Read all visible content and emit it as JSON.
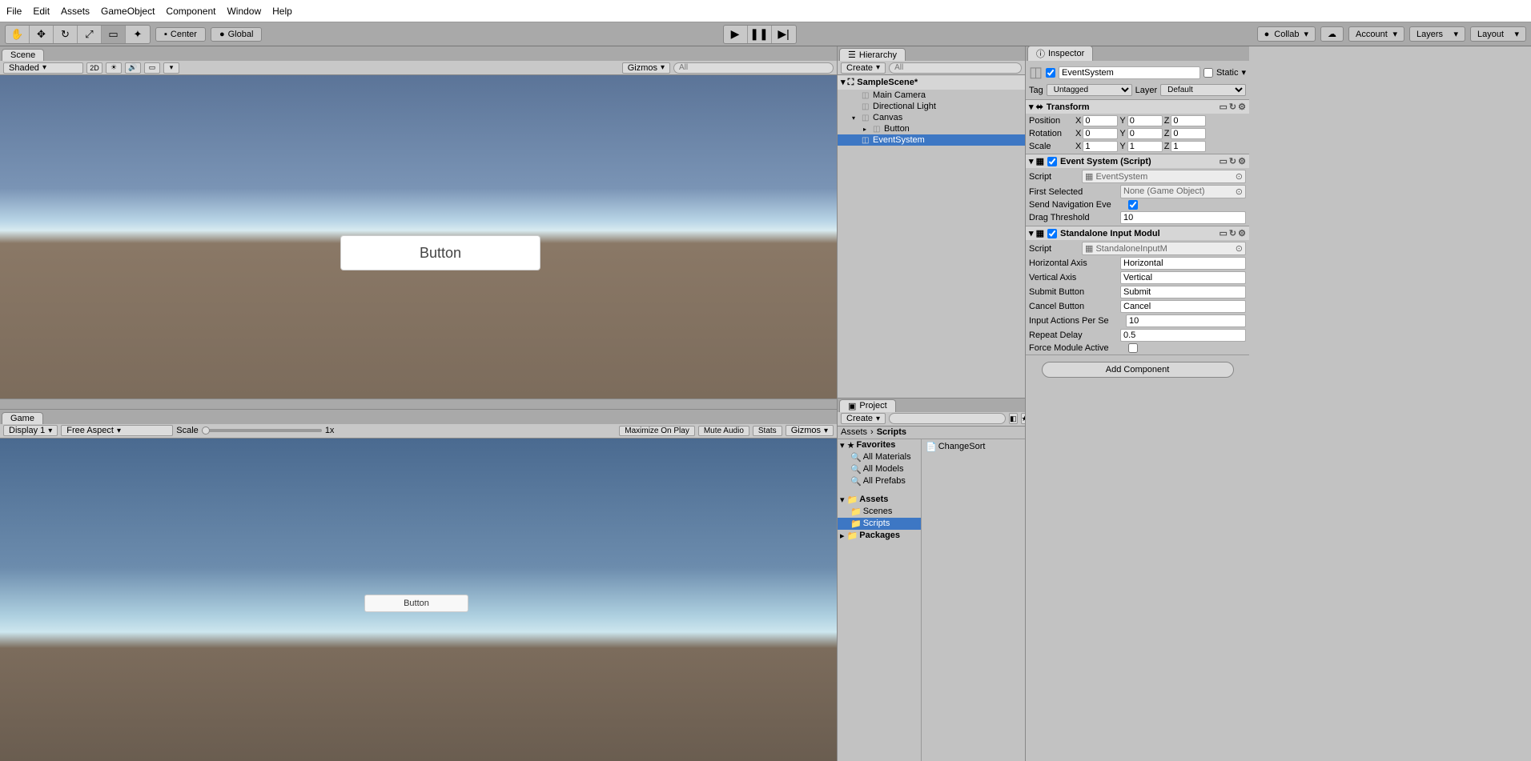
{
  "menu": [
    "File",
    "Edit",
    "Assets",
    "GameObject",
    "Component",
    "Window",
    "Help"
  ],
  "toolbar": {
    "center": "Center",
    "global": "Global",
    "collab": "Collab",
    "account": "Account",
    "layers": "Layers",
    "layout": "Layout"
  },
  "scene_tab": "Scene",
  "scene_toolbar": {
    "shaded": "Shaded",
    "two_d": "2D",
    "gizmos": "Gizmos",
    "search_ph": "All"
  },
  "scene_button_text": "Button",
  "game_tab": "Game",
  "game_toolbar": {
    "display": "Display 1",
    "aspect": "Free Aspect",
    "scale": "Scale",
    "scale_val": "1x",
    "maximize": "Maximize On Play",
    "mute": "Mute Audio",
    "stats": "Stats",
    "gizmos": "Gizmos"
  },
  "game_button_text": "Button",
  "hierarchy": {
    "title": "Hierarchy",
    "create": "Create",
    "search_ph": "All",
    "scene": "SampleScene*",
    "items": [
      {
        "label": "Main Camera",
        "indent": 1
      },
      {
        "label": "Directional Light",
        "indent": 1
      },
      {
        "label": "Canvas",
        "indent": 1,
        "expandable": true
      },
      {
        "label": "Button",
        "indent": 2,
        "expandable": true
      },
      {
        "label": "EventSystem",
        "indent": 1,
        "selected": true
      }
    ]
  },
  "project": {
    "title": "Project",
    "create": "Create",
    "breadcrumb": [
      "Assets",
      "Scripts"
    ],
    "favorites": "Favorites",
    "fav_items": [
      "All Materials",
      "All Models",
      "All Prefabs"
    ],
    "assets": "Assets",
    "asset_items": [
      "Scenes",
      "Scripts"
    ],
    "packages": "Packages",
    "content_item": "ChangeSort"
  },
  "inspector": {
    "title": "Inspector",
    "name": "EventSystem",
    "static": "Static",
    "tag_label": "Tag",
    "tag": "Untagged",
    "layer_label": "Layer",
    "layer": "Default",
    "transform": {
      "title": "Transform",
      "pos": {
        "label": "Position",
        "x": "0",
        "y": "0",
        "z": "0"
      },
      "rot": {
        "label": "Rotation",
        "x": "0",
        "y": "0",
        "z": "0"
      },
      "scale": {
        "label": "Scale",
        "x": "1",
        "y": "1",
        "z": "1"
      }
    },
    "event_system": {
      "title": "Event System (Script)",
      "script_label": "Script",
      "script": "EventSystem",
      "first_sel_label": "First Selected",
      "first_sel": "None (Game Object)",
      "send_nav_label": "Send Navigation Eve",
      "drag_thresh_label": "Drag Threshold",
      "drag_thresh": "10"
    },
    "input_module": {
      "title": "Standalone Input Modul",
      "script_label": "Script",
      "script": "StandaloneInputM",
      "h_axis_label": "Horizontal Axis",
      "h_axis": "Horizontal",
      "v_axis_label": "Vertical Axis",
      "v_axis": "Vertical",
      "submit_label": "Submit Button",
      "submit": "Submit",
      "cancel_label": "Cancel Button",
      "cancel": "Cancel",
      "actions_label": "Input Actions Per Se",
      "actions": "10",
      "repeat_label": "Repeat Delay",
      "repeat": "0.5",
      "force_label": "Force Module Active"
    },
    "add_component": "Add Component"
  }
}
